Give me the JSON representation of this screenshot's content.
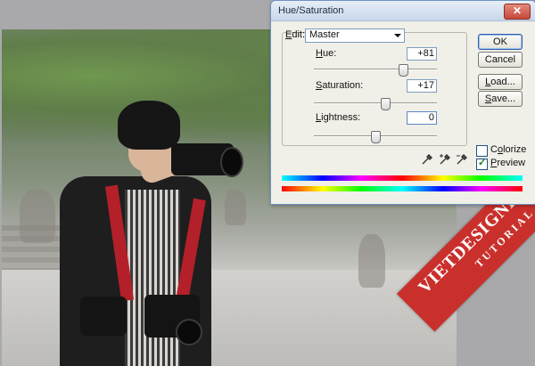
{
  "dialog": {
    "title": "Hue/Saturation",
    "close_glyph": "✕",
    "edit": {
      "label_mnemonic": "E",
      "label_rest": "dit:",
      "value": "Master"
    },
    "hue": {
      "label_mnemonic": "H",
      "label_rest": "ue:",
      "value": "+81",
      "level_fraction": 0.725
    },
    "saturation": {
      "label_mnemonic": "S",
      "label_rest": "aturation:",
      "value": "+17",
      "level_fraction": 0.585
    },
    "lightness": {
      "label_mnemonic": "L",
      "label_rest": "ightness:",
      "value": "0",
      "level_fraction": 0.5
    },
    "buttons": {
      "ok": "OK",
      "cancel": "Cancel",
      "load_mnemonic": "L",
      "load_rest": "oad...",
      "save_mnemonic": "S",
      "save_rest": "ave..."
    },
    "colorize": {
      "label_mnemonic": "o",
      "label_pre": "C",
      "label_rest": "lorize",
      "checked": false
    },
    "preview": {
      "label_mnemonic": "P",
      "label_rest": "review",
      "checked": true
    },
    "eyedroppers": [
      "eyedropper-icon",
      "eyedropper-plus-icon",
      "eyedropper-minus-icon"
    ]
  },
  "watermark": {
    "main": "VIETDESIGNER.NET",
    "sub": "TUTORIAL",
    "color": "#c9302c"
  }
}
